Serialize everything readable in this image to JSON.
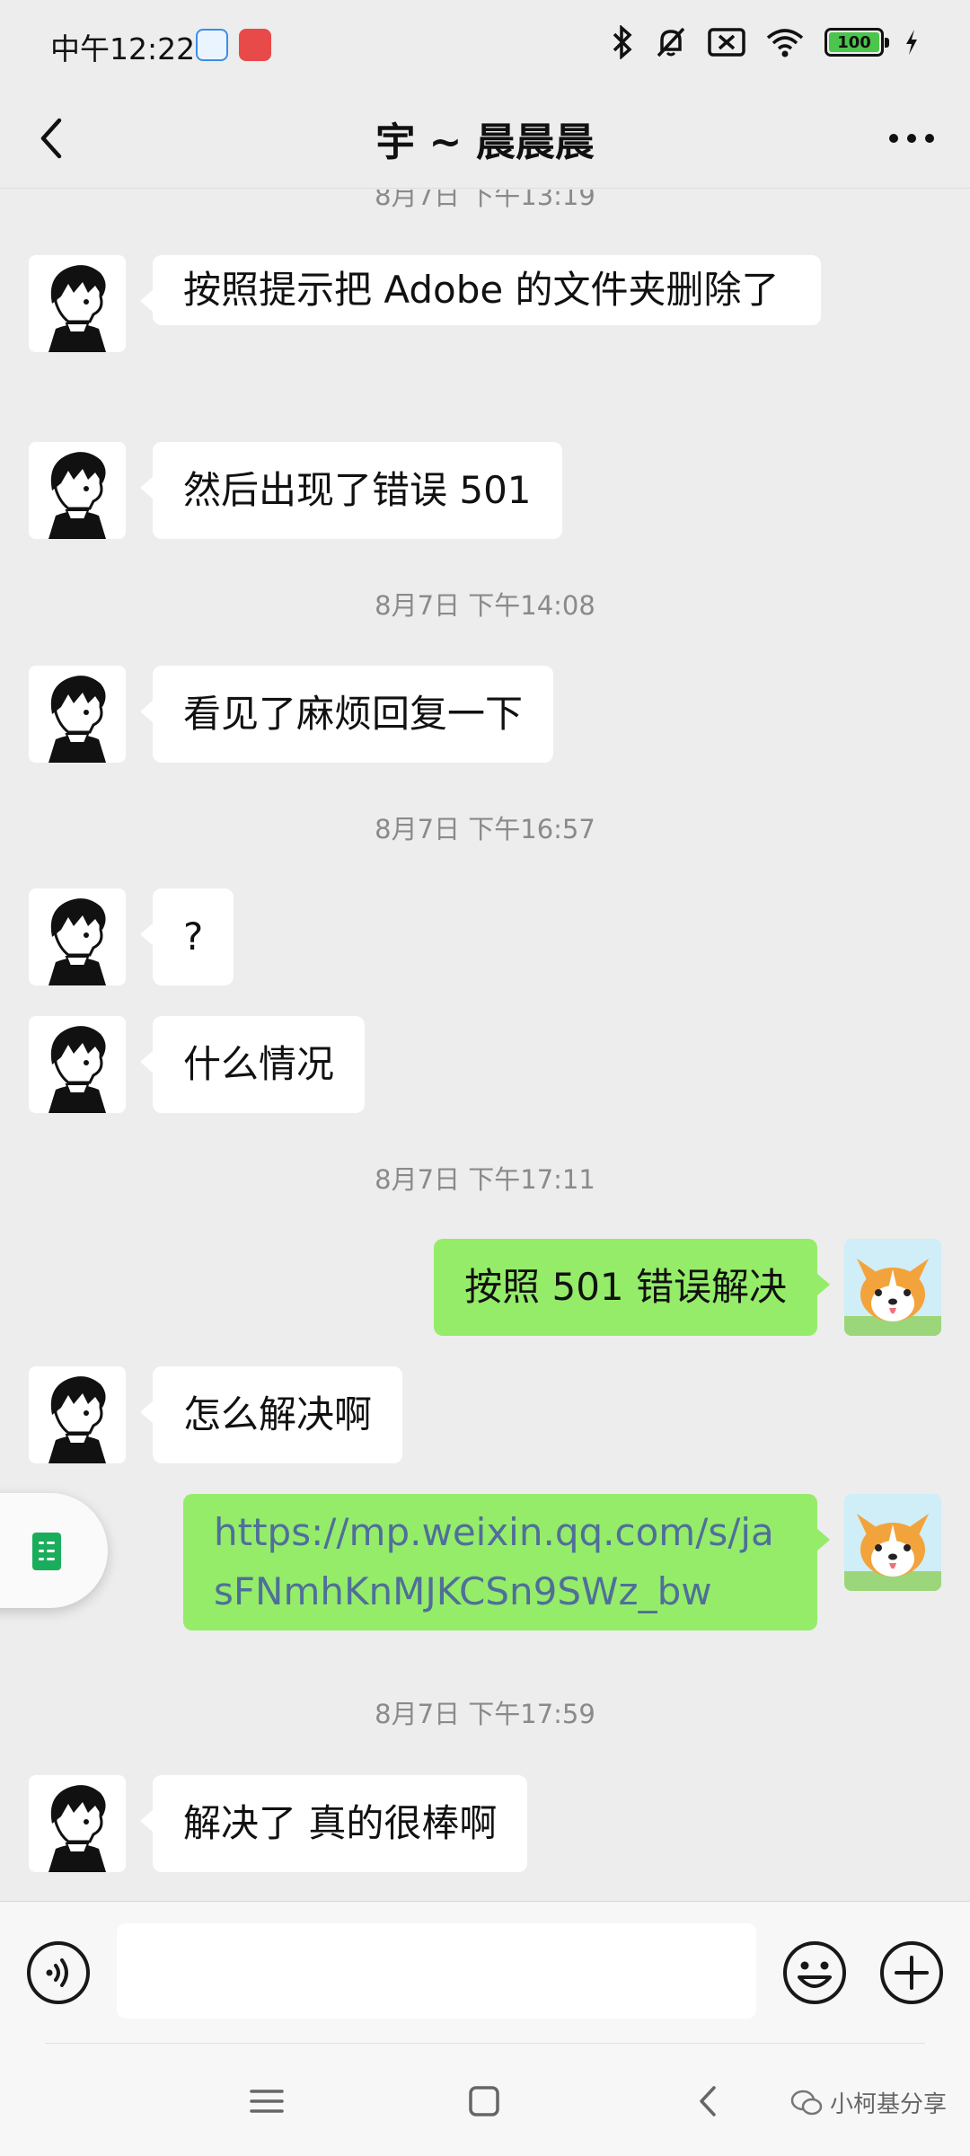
{
  "status_bar": {
    "time": "中午12:22",
    "battery": "100"
  },
  "nav": {
    "title": "宇 ~ 晨晨晨"
  },
  "chat": {
    "timestamps": [
      "8月7日 下午13:19",
      "8月7日 下午14:08",
      "8月7日 下午16:57",
      "8月7日 下午17:11",
      "8月7日 下午17:59"
    ],
    "messages": [
      {
        "from": "them",
        "text": "按照提示把 Adobe 的文件夹删除了"
      },
      {
        "from": "them",
        "text": "然后出现了错误 501"
      },
      {
        "from": "them",
        "text": "看见了麻烦回复一下"
      },
      {
        "from": "them",
        "text": "?"
      },
      {
        "from": "them",
        "text": "什么情况"
      },
      {
        "from": "me",
        "text": "按照 501 错误解决"
      },
      {
        "from": "them",
        "text": "怎么解决啊"
      },
      {
        "from": "me",
        "text": "https://mp.weixin.qq.com/s/jasFNmhKnMJKCSn9SWz_bw"
      },
      {
        "from": "them",
        "text": "解决了 真的很棒啊"
      }
    ]
  },
  "input": {
    "placeholder": ""
  },
  "watermark": {
    "text": "小柯基分享"
  },
  "colors": {
    "background": "#ededed",
    "incoming_bubble": "#ffffff",
    "outgoing_bubble": "#95ec69",
    "link": "#4f6f9a"
  },
  "icons": [
    "back-icon",
    "more-icon",
    "voice-icon",
    "emoji-icon",
    "plus-icon",
    "bluetooth-icon",
    "mute-icon",
    "wifi-icon",
    "battery-icon",
    "charging-icon",
    "menu-icon",
    "home-icon",
    "back-nav-icon",
    "wechat-icon"
  ]
}
